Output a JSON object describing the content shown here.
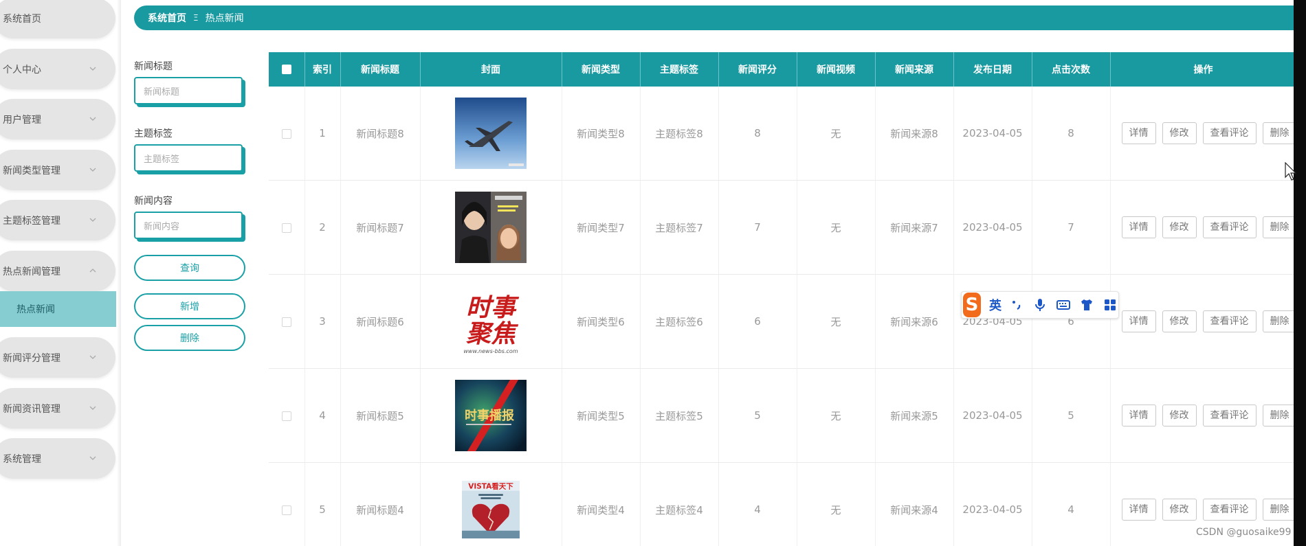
{
  "sidebar": {
    "items": [
      {
        "label": "系统首页",
        "has_chevron": false
      },
      {
        "label": "个人中心",
        "has_chevron": true
      },
      {
        "label": "用户管理",
        "has_chevron": true
      },
      {
        "label": "新闻类型管理",
        "has_chevron": true
      },
      {
        "label": "主题标签管理",
        "has_chevron": true
      },
      {
        "label": "热点新闻管理",
        "has_chevron": true,
        "expanded": true
      },
      {
        "label": "新闻评分管理",
        "has_chevron": true
      },
      {
        "label": "新闻资讯管理",
        "has_chevron": true
      },
      {
        "label": "系统管理",
        "has_chevron": true
      }
    ],
    "active_sub_item": "热点新闻"
  },
  "breadcrumb": {
    "home": "系统首页",
    "separator": "Ξ",
    "current": "热点新闻"
  },
  "filters": {
    "title_label": "新闻标题",
    "title_placeholder": "新闻标题",
    "tag_label": "主题标签",
    "tag_placeholder": "主题标签",
    "content_label": "新闻内容",
    "content_placeholder": "新闻内容",
    "query_button": "查询",
    "add_button": "新增",
    "delete_button": "删除"
  },
  "table": {
    "headers": [
      "",
      "索引",
      "新闻标题",
      "封面",
      "新闻类型",
      "主题标签",
      "新闻评分",
      "新闻视频",
      "新闻来源",
      "发布日期",
      "点击次数",
      "操作"
    ],
    "rows": [
      {
        "index": "1",
        "title": "新闻标题8",
        "cover": "fighter-jet-cover",
        "type": "新闻类型8",
        "tag": "主题标签8",
        "score": "8",
        "video": "无",
        "source": "新闻来源8",
        "date": "2023-04-05",
        "clicks": "8"
      },
      {
        "index": "2",
        "title": "新闻标题7",
        "cover": "magazine-portrait-cover",
        "type": "新闻类型7",
        "tag": "主题标签7",
        "score": "7",
        "video": "无",
        "source": "新闻来源7",
        "date": "2023-04-05",
        "clicks": "7"
      },
      {
        "index": "3",
        "title": "新闻标题6",
        "cover": "current-affairs-focus-cover",
        "cover_text": [
          "时事",
          "聚焦",
          "www.news-bbs.com"
        ],
        "type": "新闻类型6",
        "tag": "主题标签6",
        "score": "6",
        "video": "无",
        "source": "新闻来源6",
        "date": "2023-04-05",
        "clicks": "6"
      },
      {
        "index": "4",
        "title": "新闻标题5",
        "cover": "news-broadcast-cover",
        "cover_text": [
          "时事播报"
        ],
        "type": "新闻类型5",
        "tag": "主题标签5",
        "score": "5",
        "video": "无",
        "source": "新闻来源5",
        "date": "2023-04-05",
        "clicks": "5"
      },
      {
        "index": "5",
        "title": "新闻标题4",
        "cover": "vista-magazine-cover",
        "cover_text": [
          "VISTA看天下"
        ],
        "type": "新闻类型4",
        "tag": "主题标签4",
        "score": "4",
        "video": "无",
        "source": "新闻来源4",
        "date": "2023-04-05",
        "clicks": "4"
      }
    ],
    "actions": [
      "详情",
      "修改",
      "查看评论",
      "删除"
    ]
  },
  "ime": {
    "logo": "S",
    "lang": "英",
    "icons": [
      "punctuation-icon",
      "microphone-icon",
      "keyboard-icon",
      "skin-shirt-icon",
      "apps-grid-icon"
    ]
  },
  "watermark": "CSDN @guosaike99",
  "colors": {
    "accent": "#199aa0",
    "active_sub_bg": "#86cdd2",
    "menu_bg": "#e5e5e5"
  }
}
